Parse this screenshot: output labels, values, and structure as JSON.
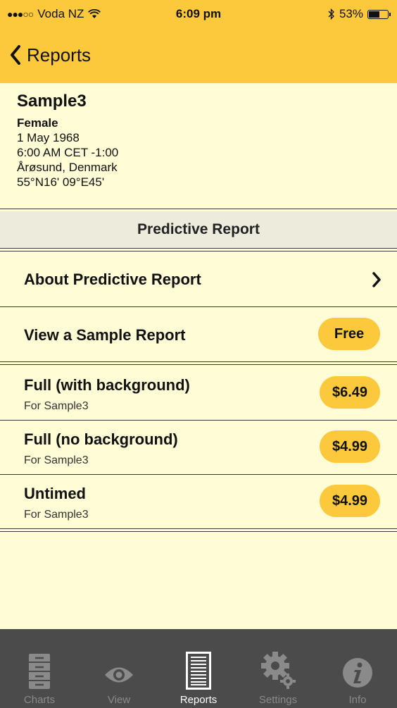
{
  "status": {
    "carrier": "Voda NZ",
    "time": "6:09 pm",
    "battery": "53%"
  },
  "nav": {
    "back_label": "Reports"
  },
  "profile": {
    "name": "Sample3",
    "gender": "Female",
    "date": "1 May 1968",
    "time": "6:00 AM CET -1:00",
    "place": "Årøsund, Denmark",
    "coords": "55°N16' 09°E45'"
  },
  "section": {
    "title": "Predictive Report"
  },
  "about": {
    "label": "About Predictive Report"
  },
  "sample": {
    "label": "View a Sample Report",
    "price": "Free"
  },
  "products": [
    {
      "title": "Full (with background)",
      "subtitle": "For Sample3",
      "price": "$6.49"
    },
    {
      "title": "Full (no background)",
      "subtitle": "For Sample3",
      "price": "$4.99"
    },
    {
      "title": "Untimed",
      "subtitle": "For Sample3",
      "price": "$4.99"
    }
  ],
  "tabs": [
    {
      "label": "Charts",
      "icon": "cabinet-icon"
    },
    {
      "label": "View",
      "icon": "eye-icon"
    },
    {
      "label": "Reports",
      "icon": "document-icon",
      "active": true
    },
    {
      "label": "Settings",
      "icon": "gears-icon"
    },
    {
      "label": "Info",
      "icon": "info-icon"
    }
  ],
  "colors": {
    "accent": "#fcc93c",
    "background": "#fffcd6",
    "tabbar": "#4b4b4b"
  }
}
